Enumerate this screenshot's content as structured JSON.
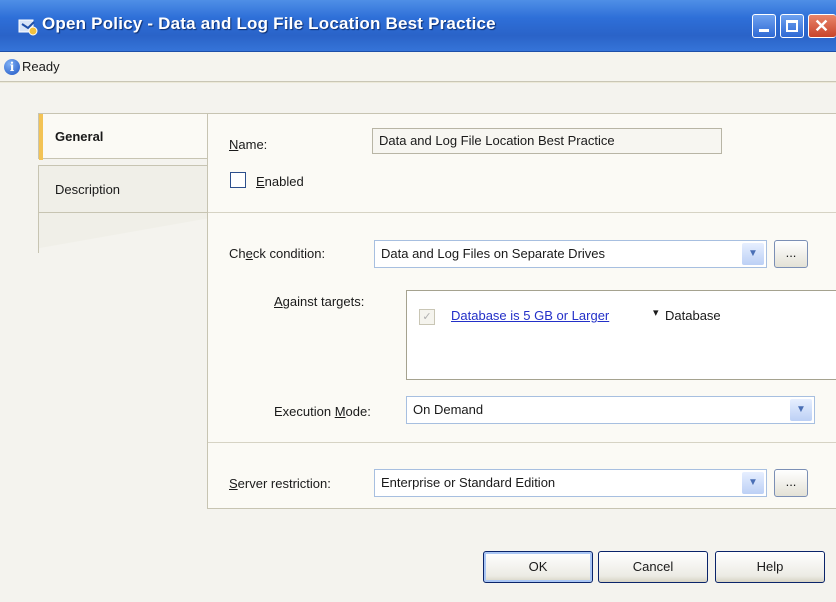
{
  "window": {
    "title": "Open Policy - Data and Log File Location Best Practice",
    "icon": "policy-icon"
  },
  "status": {
    "icon": "info-icon",
    "text": "Ready"
  },
  "tabs": [
    {
      "label": "General",
      "selected": true
    },
    {
      "label": "Description",
      "selected": false
    }
  ],
  "form": {
    "name_label": "Name:",
    "name_value": "Data and Log File Location Best Practice",
    "enabled_label": "Enabled",
    "enabled_checked": false,
    "check_condition_label": "Check condition:",
    "check_condition_value": "Data and Log Files on Separate Drives",
    "against_targets_label": "Against targets:",
    "target_link": "Database is 5 GB or Larger",
    "target_separator": "▾",
    "target_type": "Database",
    "execution_mode_label": "Execution Mode:",
    "execution_mode_value": "On Demand",
    "server_restriction_label": "Server restriction:",
    "server_restriction_value": "Enterprise or Standard Edition",
    "browse_label": "..."
  },
  "buttons": {
    "ok": "OK",
    "cancel": "Cancel",
    "help": "Help"
  },
  "colors": {
    "titlebar": "#2e6fd8",
    "link": "#2330c8",
    "tab_accent": "#f3c355"
  }
}
